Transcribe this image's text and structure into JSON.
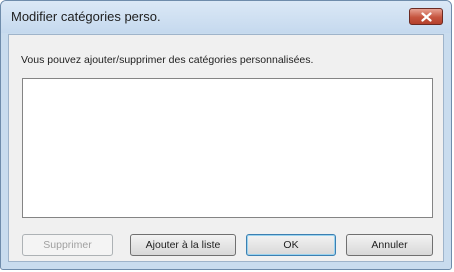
{
  "window": {
    "title": "Modifier catégories perso."
  },
  "dialog": {
    "description": "Vous pouvez ajouter/supprimer des catégories personnalisées.",
    "list_items": []
  },
  "buttons": {
    "delete_label": "Supprimer",
    "add_label": "Ajouter à la liste",
    "ok_label": "OK",
    "cancel_label": "Annuler"
  },
  "icons": {
    "close": "close-icon"
  },
  "colors": {
    "titlebar": "#c9dcee",
    "close_button": "#c6553f",
    "client": "#f0f0f0"
  }
}
